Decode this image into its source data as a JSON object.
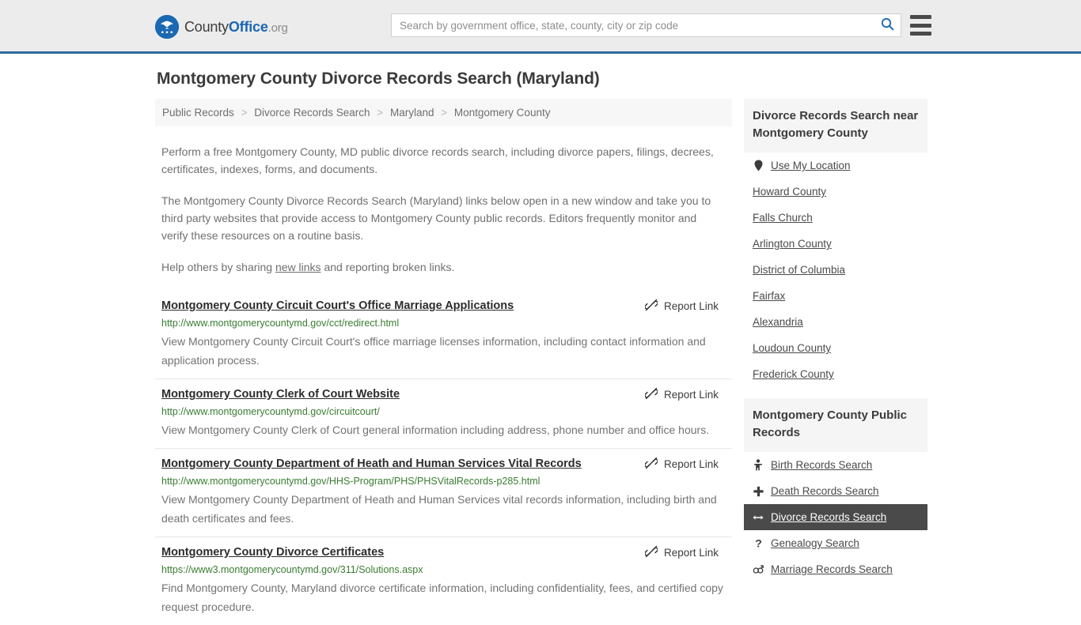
{
  "header": {
    "logo": {
      "icon": "eagle-seal-icon",
      "part1": "County",
      "part2": "Office",
      "part3": ".org"
    },
    "search": {
      "placeholder": "Search by government office, state, county, city or zip code",
      "value": "",
      "search_icon": "search-icon"
    },
    "menu_icon": "hamburger-menu-icon"
  },
  "page": {
    "title": "Montgomery County Divorce Records Search (Maryland)"
  },
  "breadcrumb": {
    "separator": ">",
    "items": [
      {
        "label": "Public Records"
      },
      {
        "label": "Divorce Records Search"
      },
      {
        "label": "Maryland"
      },
      {
        "label": "Montgomery County"
      }
    ]
  },
  "intro": {
    "paragraph1": "Perform a free Montgomery County, MD public divorce records search, including divorce papers, filings, decrees, certificates, indexes, forms, and documents.",
    "paragraph2": "The Montgomery County Divorce Records Search (Maryland) links below open in a new window and take you to third party websites that provide access to Montgomery County public records. Editors frequently monitor and verify these resources on a routine basis.",
    "paragraph3_before": "Help others by sharing ",
    "paragraph3_link": "new links",
    "paragraph3_after": " and reporting broken links."
  },
  "results": {
    "report_label": "Report Link",
    "report_icon": "broken-link-icon",
    "items": [
      {
        "title": "Montgomery County Circuit Court's Office Marriage Applications",
        "url": "http://www.montgomerycountymd.gov/cct/redirect.html",
        "description": "View Montgomery County Circuit Court's office marriage licenses information, including contact information and application process."
      },
      {
        "title": "Montgomery County Clerk of Court Website",
        "url": "http://www.montgomerycountymd.gov/circuitcourt/",
        "description": "View Montgomery County Clerk of Court general information including address, phone number and office hours."
      },
      {
        "title": "Montgomery County Department of Heath and Human Services Vital Records",
        "url": "http://www.montgomerycountymd.gov/HHS-Program/PHS/PHSVitalRecords-p285.html",
        "description": "View Montgomery County Department of Heath and Human Services vital records information, including birth and death certificates and fees."
      },
      {
        "title": "Montgomery County Divorce Certificates",
        "url": "https://www3.montgomerycountymd.gov/311/Solutions.aspx",
        "description": "Find Montgomery County, Maryland divorce certificate information, including confidentiality, fees, and certified copy request procedure."
      }
    ]
  },
  "sidebar": {
    "nearby": {
      "heading": "Divorce Records Search near Montgomery County",
      "items": [
        {
          "label": "Use My Location",
          "icon": "map-pin-icon",
          "glyph": "•",
          "active": false
        },
        {
          "label": "Howard County",
          "icon": "",
          "glyph": "",
          "active": false
        },
        {
          "label": "Falls Church",
          "icon": "",
          "glyph": "",
          "active": false
        },
        {
          "label": "Arlington County",
          "icon": "",
          "glyph": "",
          "active": false
        },
        {
          "label": "District of Columbia",
          "icon": "",
          "glyph": "",
          "active": false
        },
        {
          "label": "Fairfax",
          "icon": "",
          "glyph": "",
          "active": false
        },
        {
          "label": "Alexandria",
          "icon": "",
          "glyph": "",
          "active": false
        },
        {
          "label": "Loudoun County",
          "icon": "",
          "glyph": "",
          "active": false
        },
        {
          "label": "Frederick County",
          "icon": "",
          "glyph": "",
          "active": false
        }
      ]
    },
    "public_records": {
      "heading": "Montgomery County Public Records",
      "items": [
        {
          "label": "Birth Records Search",
          "icon": "baby-icon",
          "glyph": "Ѧ",
          "active": false
        },
        {
          "label": "Death Records Search",
          "icon": "cross-icon",
          "glyph": "✚",
          "active": false
        },
        {
          "label": "Divorce Records Search",
          "icon": "left-right-arrow-icon",
          "glyph": "↔",
          "active": true
        },
        {
          "label": "Genealogy Search",
          "icon": "question-mark-icon",
          "glyph": "?",
          "active": false
        },
        {
          "label": "Marriage Records Search",
          "icon": "male-female-icon",
          "glyph": "⚤",
          "active": false
        }
      ]
    }
  },
  "colors": {
    "brand_blue": "#1b68b3",
    "header_border": "#31689c",
    "header_bg": "#ececec",
    "url_green": "#3a7d32",
    "active_bg": "#4a4a4a"
  }
}
